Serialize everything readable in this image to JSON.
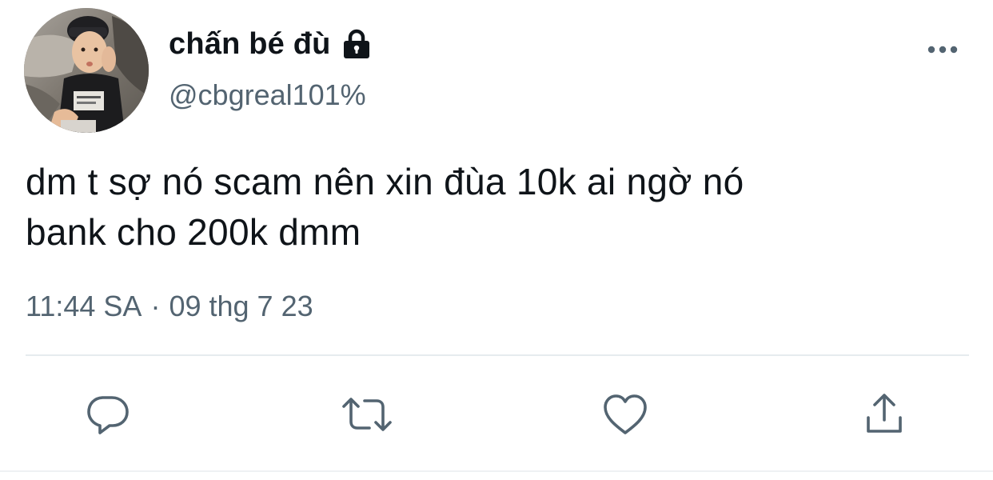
{
  "user": {
    "display_name": "chấn bé đù",
    "handle": "@cbgreal101%",
    "protected_icon": "lock-icon",
    "avatar": "profile-photo"
  },
  "tweet": {
    "text": "dm t sợ nó scam nên xin đùa 10k ai ngờ nó\nbank cho 200k dmm",
    "time": "11:44 SA",
    "separator": "·",
    "date": "09 thg 7 23"
  },
  "actions": [
    {
      "name": "reply",
      "icon": "reply-icon"
    },
    {
      "name": "retweet",
      "icon": "retweet-icon"
    },
    {
      "name": "like",
      "icon": "heart-icon"
    },
    {
      "name": "share",
      "icon": "share-icon"
    }
  ],
  "menu": {
    "icon": "more-icon"
  },
  "colors": {
    "text_primary": "#0f1419",
    "text_secondary": "#536471",
    "icon": "#536471",
    "divider": "#e6ebee"
  }
}
